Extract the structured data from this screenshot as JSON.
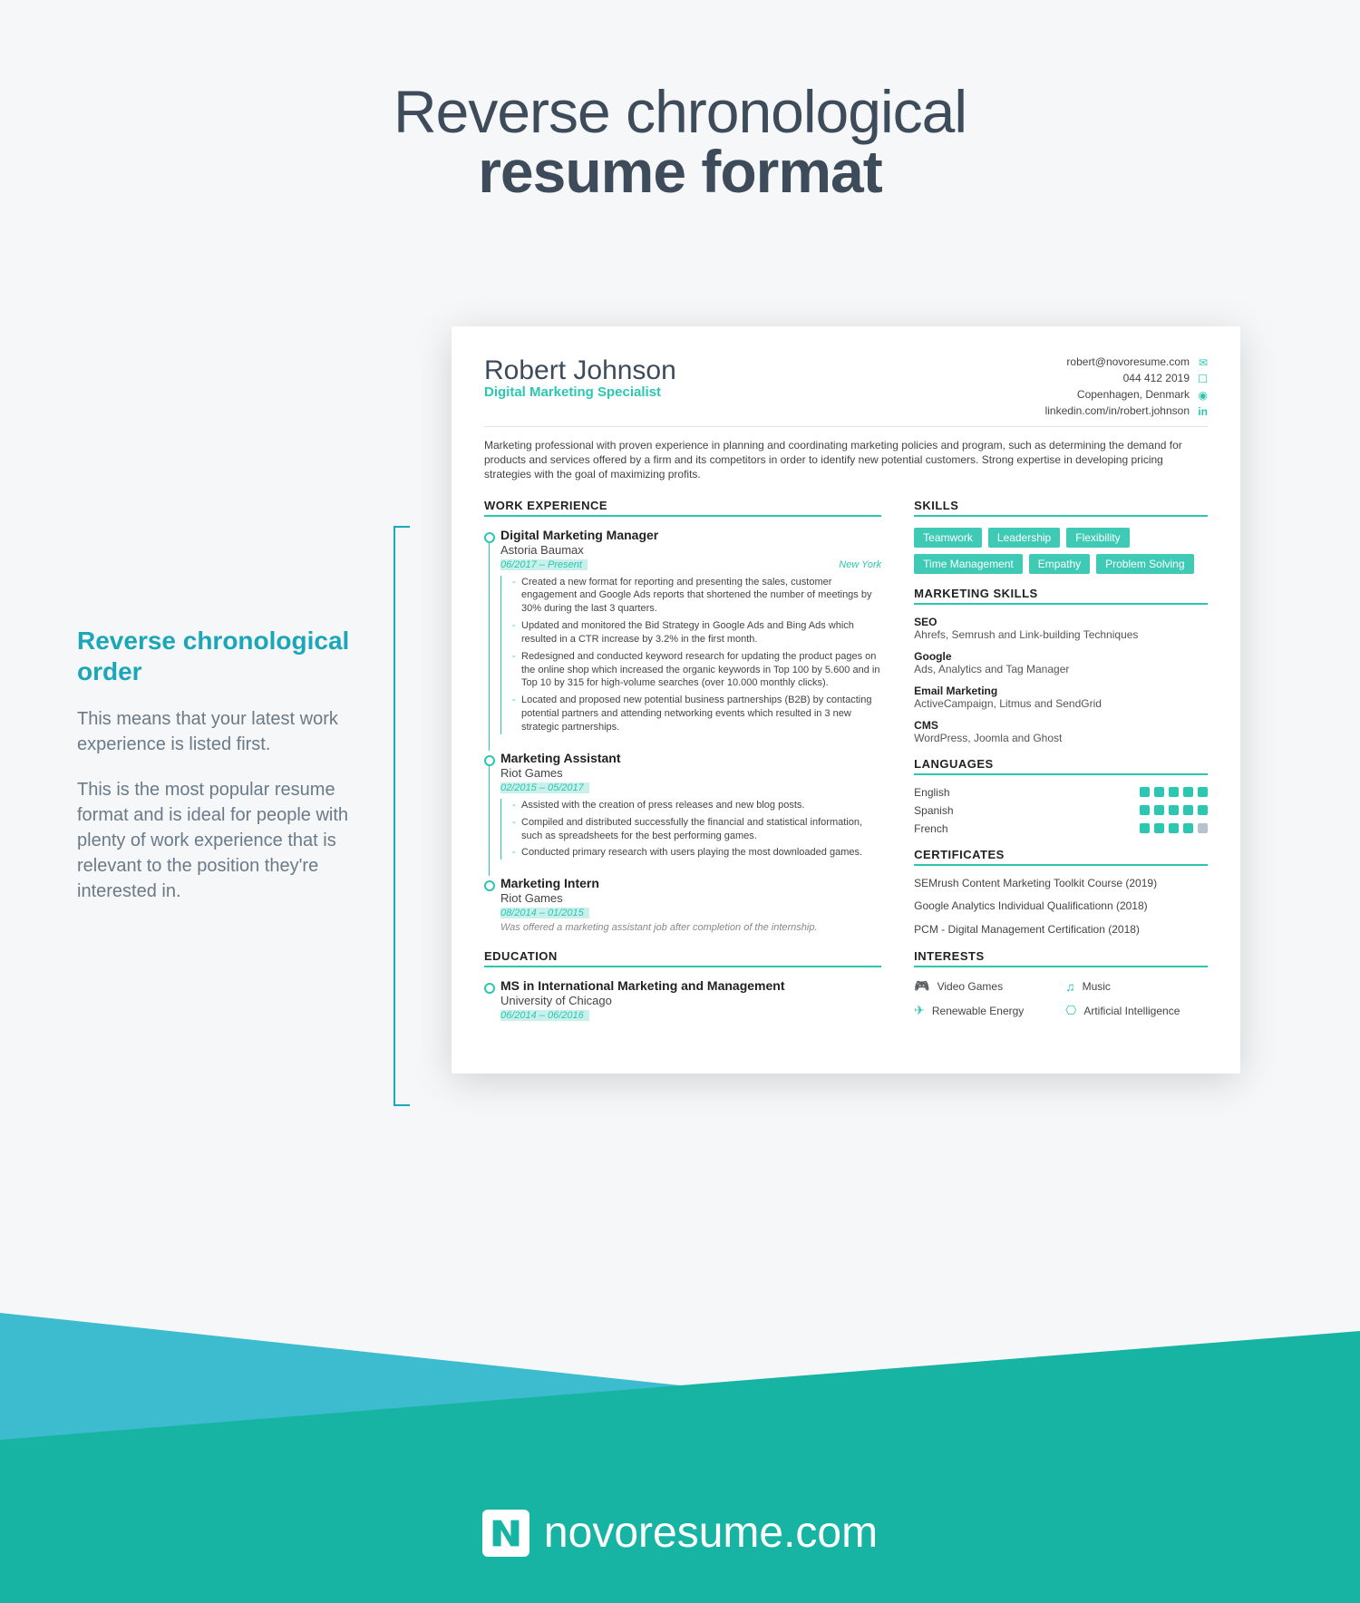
{
  "header": {
    "line1": "Reverse chronological",
    "line2": "resume format"
  },
  "sidebar": {
    "title": "Reverse chronological order",
    "para1": "This means that your latest work experience is listed first.",
    "para2": "This is the most popular resume format and is ideal for people with plenty of work experience that is relevant to the position they're interested in."
  },
  "resume": {
    "name": "Robert Johnson",
    "title": "Digital Marketing Specialist",
    "email": "robert@novoresume.com",
    "phone": "044 412 2019",
    "location": "Copenhagen, Denmark",
    "linkedin": "linkedin.com/in/robert.johnson",
    "summary": "Marketing professional with proven experience in planning and coordinating marketing policies and program, such as determining the demand for products and services offered by a firm and its competitors in order to identify new potential customers. Strong expertise in developing pricing strategies with the goal of maximizing profits.",
    "sections": {
      "work": "WORK EXPERIENCE",
      "skills": "SKILLS",
      "mkskills": "MARKETING SKILLS",
      "languages": "LANGUAGES",
      "certs": "CERTIFICATES",
      "interests": "INTERESTS",
      "education": "EDUCATION"
    },
    "jobs": [
      {
        "title": "Digital Marketing Manager",
        "company": "Astoria Baumax",
        "dates": "06/2017 – Present",
        "loc": "New York",
        "bullets": [
          "Created a new format for reporting and presenting the sales, customer engagement and Google Ads reports that shortened the number of meetings by 30% during the last 3 quarters.",
          "Updated and monitored the Bid Strategy in Google Ads and Bing Ads which resulted in a CTR increase by 3.2% in the first month.",
          "Redesigned and conducted keyword research for updating the product pages on the online shop which increased the organic keywords in Top 100 by 5.600 and in Top 10 by 315 for high-volume searches (over 10.000 monthly clicks).",
          "Located and proposed new potential business partnerships (B2B) by contacting potential partners and attending networking events which resulted in 3 new strategic partnerships."
        ]
      },
      {
        "title": "Marketing Assistant",
        "company": "Riot Games",
        "dates": "02/2015 – 05/2017",
        "loc": "",
        "bullets": [
          "Assisted with the creation of press releases and new blog posts.",
          "Compiled and distributed successfully the financial and statistical information, such as spreadsheets for the best performing games.",
          "Conducted primary research with users playing the most downloaded games."
        ]
      },
      {
        "title": "Marketing Intern",
        "company": "Riot Games",
        "dates": "08/2014 – 01/2015",
        "loc": "",
        "note": "Was offered a marketing assistant job after completion of the internship."
      }
    ],
    "education": {
      "degree": "MS in International Marketing and Management",
      "school": "University of Chicago",
      "dates": "06/2014 – 06/2016"
    },
    "soft_skills": [
      "Teamwork",
      "Leadership",
      "Flexibility",
      "Time Management",
      "Empathy",
      "Problem Solving"
    ],
    "marketing_skills": [
      {
        "name": "SEO",
        "desc": "Ahrefs, Semrush and Link-building Techniques"
      },
      {
        "name": "Google",
        "desc": "Ads, Analytics and Tag Manager"
      },
      {
        "name": "Email Marketing",
        "desc": "ActiveCampaign, Litmus and SendGrid"
      },
      {
        "name": "CMS",
        "desc": "WordPress, Joomla and Ghost"
      }
    ],
    "languages": [
      {
        "name": "English",
        "level": 5
      },
      {
        "name": "Spanish",
        "level": 5
      },
      {
        "name": "French",
        "level": 4
      }
    ],
    "certificates": [
      "SEMrush Content Marketing Toolkit Course (2019)",
      "Google Analytics Individual Qualificationn (2018)",
      "PCM - Digital Management Certification (2018)"
    ],
    "interests": [
      {
        "icon": "🎮",
        "label": "Video Games"
      },
      {
        "icon": "♫",
        "label": "Music"
      },
      {
        "icon": "✈",
        "label": "Renewable Energy"
      },
      {
        "icon": "⎔",
        "label": "Artificial Intelligence"
      }
    ]
  },
  "footer": {
    "brand": "novoresume.com"
  }
}
